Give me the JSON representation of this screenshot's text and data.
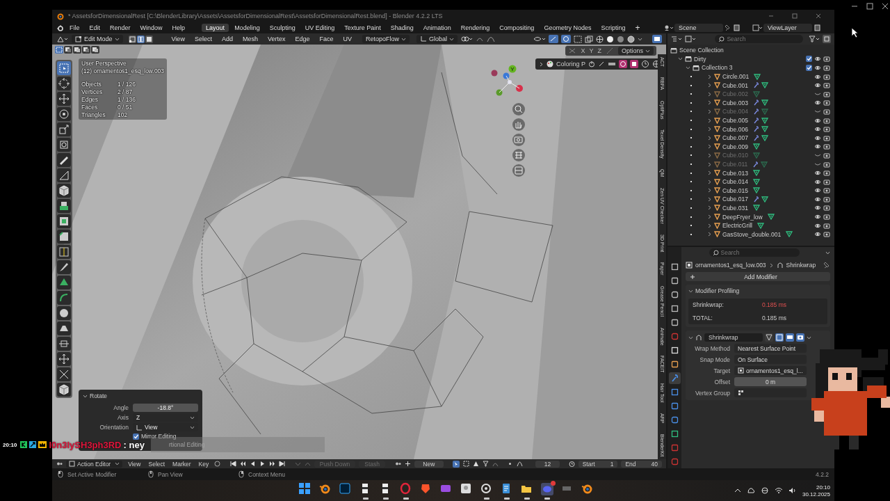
{
  "title_bar": {
    "title": "* AssetsforDimensionalRest [C:\\BlenderLibrary\\Assets\\AssetsforDimensionalRest\\AssetsforDimensionalRest.blend] - Blender 4.2.2 LTS"
  },
  "menu": [
    "File",
    "Edit",
    "Render",
    "Window",
    "Help"
  ],
  "workspaces": [
    {
      "label": "Layout",
      "selected": true
    },
    {
      "label": "Modeling",
      "selected": false
    },
    {
      "label": "Sculpting",
      "selected": false
    },
    {
      "label": "UV Editing",
      "selected": false
    },
    {
      "label": "Texture Paint",
      "selected": false
    },
    {
      "label": "Shading",
      "selected": false
    },
    {
      "label": "Animation",
      "selected": false
    },
    {
      "label": "Rendering",
      "selected": false
    },
    {
      "label": "Compositing",
      "selected": false
    },
    {
      "label": "Geometry Nodes",
      "selected": false
    },
    {
      "label": "Scripting",
      "selected": false
    }
  ],
  "add_workspace": "+",
  "scene": "Scene",
  "view_layer": "ViewLayer",
  "viewport": {
    "mode": "Edit Mode",
    "select_modes": [
      {
        "kind": "vertex",
        "selected": false
      },
      {
        "kind": "edge",
        "selected": true
      },
      {
        "kind": "face",
        "selected": false
      }
    ],
    "menus": [
      "View",
      "Select",
      "Add",
      "Mesh",
      "Vertex",
      "Edge",
      "Face",
      "UV"
    ],
    "addon_menu": "RetopoFlow",
    "orientation": "Global",
    "view_name": "User Perspective",
    "object_name": "(12) ornamentos1_esq_low.003",
    "stats": [
      {
        "label": "Objects",
        "value": "1 / 126"
      },
      {
        "label": "Vertices",
        "value": "2 / 87"
      },
      {
        "label": "Edges",
        "value": "1 / 136"
      },
      {
        "label": "Faces",
        "value": "0 / 51"
      },
      {
        "label": "Triangles",
        "value": "102"
      }
    ],
    "axes": [
      "X",
      "Y",
      "Z"
    ],
    "options": "Options",
    "coloring_panel": "Coloring P",
    "gizmo_label": "Y",
    "tools": [
      {
        "kind": "select",
        "selected": true
      },
      {
        "kind": "cursor",
        "selected": false
      },
      {
        "kind": "move",
        "selected": false
      },
      {
        "kind": "rotate",
        "selected": false
      },
      {
        "kind": "scale",
        "selected": false
      },
      {
        "kind": "transform",
        "selected": false
      },
      {
        "kind": "annotate",
        "selected": false
      },
      {
        "kind": "measure",
        "selected": false
      },
      {
        "kind": "cube",
        "selected": false
      },
      {
        "kind": "extrude",
        "selected": false
      },
      {
        "kind": "inset",
        "selected": false
      },
      {
        "kind": "bevel",
        "selected": false
      },
      {
        "kind": "loopcut",
        "selected": false
      },
      {
        "kind": "knife",
        "selected": false
      },
      {
        "kind": "polybuild",
        "selected": false
      },
      {
        "kind": "spin",
        "selected": false
      },
      {
        "kind": "smooth",
        "selected": false
      },
      {
        "kind": "slide",
        "selected": false
      },
      {
        "kind": "shrink",
        "selected": false
      },
      {
        "kind": "move",
        "selected": false
      },
      {
        "kind": "rip",
        "selected": false
      },
      {
        "kind": "cube",
        "selected": false
      }
    ],
    "side_tabs": [
      "ACT",
      "RBFA",
      "OptiPlus",
      "Texel Density",
      "QM",
      "Zen UV Checker",
      "3D Print",
      "Paper",
      "Grease Pencil",
      "Animate",
      "FACEIT",
      "Hair Tool",
      "ARP",
      "BlenderKit"
    ],
    "operator_panel": {
      "title": "Rotate",
      "fields": [
        {
          "label": "Angle",
          "value": "-18.8°",
          "kind": "number"
        },
        {
          "label": "Axis",
          "value": "Z",
          "kind": "dropdown"
        },
        {
          "label": "Orientation",
          "value": "View",
          "kind": "dropdown"
        }
      ],
      "options": [
        {
          "label": "Mirror Editing",
          "checked": true
        }
      ],
      "covered_text": "rtional Editing"
    }
  },
  "outliner": {
    "search_placeholder": "Search",
    "tree": [
      {
        "name": "Scene Collection",
        "kind": "scene",
        "children": [
          {
            "name": "Dirty",
            "kind": "collection",
            "expanded": true,
            "checked": true,
            "children": [
              {
                "name": "Collection 3",
                "kind": "collection",
                "expanded": true,
                "checked": true,
                "children": [
                  {
                    "name": "Circle.001",
                    "kind": "object",
                    "expanded": false,
                    "visible": true,
                    "modifier": false
                  },
                  {
                    "name": "Cube.001",
                    "kind": "object",
                    "expanded": false,
                    "visible": true,
                    "modifier": true
                  },
                  {
                    "name": "Cube.002",
                    "kind": "object",
                    "expanded": false,
                    "visible": false,
                    "modifier": false
                  },
                  {
                    "name": "Cube.003",
                    "kind": "object",
                    "expanded": false,
                    "visible": true,
                    "modifier": true
                  },
                  {
                    "name": "Cube.004",
                    "kind": "object",
                    "expanded": false,
                    "visible": false,
                    "modifier": true
                  },
                  {
                    "name": "Cube.005",
                    "kind": "object",
                    "expanded": false,
                    "visible": true,
                    "modifier": true
                  },
                  {
                    "name": "Cube.006",
                    "kind": "object",
                    "expanded": false,
                    "visible": true,
                    "modifier": true
                  },
                  {
                    "name": "Cube.007",
                    "kind": "object",
                    "expanded": false,
                    "visible": true,
                    "modifier": true
                  },
                  {
                    "name": "Cube.009",
                    "kind": "object",
                    "expanded": false,
                    "visible": true,
                    "modifier": false
                  },
                  {
                    "name": "Cube.010",
                    "kind": "object",
                    "expanded": false,
                    "visible": false,
                    "modifier": false
                  },
                  {
                    "name": "Cube.011",
                    "kind": "object",
                    "expanded": false,
                    "visible": false,
                    "modifier": true
                  },
                  {
                    "name": "Cube.013",
                    "kind": "object",
                    "expanded": false,
                    "visible": true,
                    "modifier": false
                  },
                  {
                    "name": "Cube.014",
                    "kind": "object",
                    "expanded": false,
                    "visible": true,
                    "modifier": false
                  },
                  {
                    "name": "Cube.015",
                    "kind": "object",
                    "expanded": false,
                    "visible": true,
                    "modifier": false
                  },
                  {
                    "name": "Cube.017",
                    "kind": "object",
                    "expanded": false,
                    "visible": true,
                    "modifier": true
                  },
                  {
                    "name": "Cube.031",
                    "kind": "object",
                    "expanded": false,
                    "visible": true,
                    "modifier": false
                  },
                  {
                    "name": "DeepFryer_low",
                    "kind": "object",
                    "expanded": false,
                    "visible": true,
                    "modifier": false
                  },
                  {
                    "name": "ElectricGrill",
                    "kind": "object",
                    "expanded": false,
                    "visible": true,
                    "modifier": false
                  },
                  {
                    "name": "GasStove_double.001",
                    "kind": "object",
                    "expanded": false,
                    "visible": true,
                    "modifier": false
                  }
                ]
              }
            ]
          }
        ]
      }
    ]
  },
  "properties": {
    "search_placeholder": "Search",
    "tabs": [
      {
        "kind": "tool",
        "selected": false
      },
      {
        "kind": "render",
        "selected": false
      },
      {
        "kind": "output",
        "selected": false
      },
      {
        "kind": "view_layer",
        "selected": false
      },
      {
        "kind": "scene",
        "selected": false
      },
      {
        "kind": "world",
        "selected": false
      },
      {
        "kind": "collection",
        "selected": false
      },
      {
        "kind": "object",
        "selected": false
      },
      {
        "kind": "modifier",
        "selected": true
      },
      {
        "kind": "particles",
        "selected": false
      },
      {
        "kind": "physics",
        "selected": false
      },
      {
        "kind": "constraints",
        "selected": false
      },
      {
        "kind": "data",
        "selected": false
      },
      {
        "kind": "material",
        "selected": false
      },
      {
        "kind": "texture",
        "selected": false
      }
    ],
    "object": "ornamentos1_esq_low.003",
    "modifier": "Shrinkwrap",
    "add_button": "Add Modifier",
    "profiling": {
      "title": "Modifier Profiling",
      "rows": [
        {
          "label": "Shrinkwrap:",
          "value": "0.185 ms",
          "warn": true
        },
        {
          "label": "TOTAL:",
          "value": "0.185 ms",
          "warn": false
        }
      ]
    },
    "modifier_panel": {
      "name": "Shrinkwrap",
      "toggles": [
        {
          "kind": "on_cage",
          "on": false
        },
        {
          "kind": "edit_mode",
          "on": true
        },
        {
          "kind": "viewport",
          "on": true
        },
        {
          "kind": "render",
          "on": true
        }
      ],
      "fields": [
        {
          "label": "Wrap Method",
          "value": "Nearest Surface Point",
          "kind": "dropdown"
        },
        {
          "label": "Snap Mode",
          "value": "On Surface",
          "kind": "dropdown"
        },
        {
          "label": "Target",
          "value": "ornamentos1_esq_l...",
          "kind": "object"
        },
        {
          "label": "Offset",
          "value": "0 m",
          "kind": "number"
        },
        {
          "label": "Vertex Group",
          "kind": "group"
        }
      ]
    }
  },
  "timeline": {
    "editor": "Action Editor",
    "menus": [
      "View",
      "Select",
      "Marker",
      "Key"
    ],
    "actions": [
      {
        "label": "Push Down",
        "disabled": true
      },
      {
        "label": "Stash",
        "disabled": true
      }
    ],
    "new": "New",
    "frame": "12",
    "start_label": "Start",
    "start": "1",
    "end_label": "End",
    "end": "40"
  },
  "status_bar": {
    "hints": [
      "Set Active Modifier",
      "Pan View",
      "Context Menu"
    ],
    "version": "4.2.2"
  },
  "chat": {
    "time": "20:10",
    "user": "l0n3lySH3ph3RD",
    "message": ": ney"
  },
  "taskbar": {
    "time": "20:10",
    "date": "30.12.2025",
    "apps": [
      {
        "kind": "start",
        "running": false,
        "notification": false
      },
      {
        "kind": "blender",
        "running": false,
        "notification": false
      },
      {
        "kind": "photo",
        "running": false,
        "notification": false
      },
      {
        "kind": "archive",
        "running": true,
        "notification": false
      },
      {
        "kind": "archive",
        "running": true,
        "notification": false
      },
      {
        "kind": "ring",
        "running": true,
        "notification": false
      },
      {
        "kind": "lion",
        "running": false,
        "notification": false
      },
      {
        "kind": "purple",
        "running": false,
        "notification": false
      },
      {
        "kind": "image",
        "running": false,
        "notification": false
      },
      {
        "kind": "record",
        "running": true,
        "notification": false
      },
      {
        "kind": "notes",
        "running": true,
        "notification": false
      },
      {
        "kind": "folder",
        "running": true,
        "notification": false
      },
      {
        "kind": "chat",
        "running": true,
        "notification": true
      },
      {
        "kind": "grey",
        "running": false,
        "notification": false
      },
      {
        "kind": "blender",
        "running": false,
        "notification": false
      }
    ]
  }
}
